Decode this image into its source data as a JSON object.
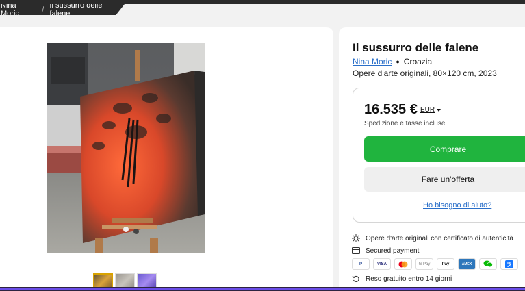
{
  "breadcrumb": {
    "artist": "Nina Moric",
    "separator": "/",
    "artwork": "Il sussurro delle falene"
  },
  "artwork": {
    "title": "Il sussurro delle falene",
    "artist": "Nina Moric",
    "country": "Croazia",
    "subtitle": "Opere d'arte originali, 80×120 cm, 2023"
  },
  "purchase": {
    "price": "16.535 €",
    "currency": "EUR",
    "shipping_note": "Spedizione e tasse incluse",
    "buy_label": "Comprare",
    "offer_label": "Fare un'offerta",
    "help_label": "Ho bisogno di aiuto?"
  },
  "features": {
    "certificate": "Opere d'arte originali con certificato di autenticità",
    "payment": "Secured payment",
    "returns": "Reso gratuito entro 14 giorni"
  },
  "payment_methods": {
    "paypal": "P",
    "visa": "VISA",
    "gpay": "G Pay",
    "applepay": "Pay",
    "amex": "AMEX"
  },
  "colors": {
    "buy": "#20b43e",
    "link": "#2a6fc9",
    "thumb_active": "#d9a300"
  }
}
